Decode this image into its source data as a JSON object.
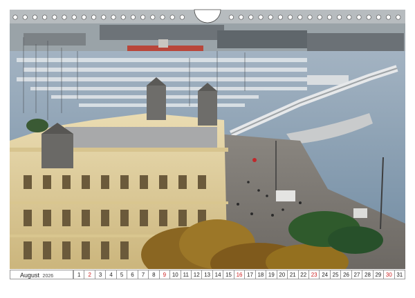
{
  "calendar": {
    "month": "August",
    "year": "2026",
    "days": [
      {
        "n": "1",
        "red": false
      },
      {
        "n": "2",
        "red": true
      },
      {
        "n": "3",
        "red": false
      },
      {
        "n": "4",
        "red": false
      },
      {
        "n": "5",
        "red": false
      },
      {
        "n": "6",
        "red": false
      },
      {
        "n": "7",
        "red": false
      },
      {
        "n": "8",
        "red": false
      },
      {
        "n": "9",
        "red": true
      },
      {
        "n": "10",
        "red": false
      },
      {
        "n": "11",
        "red": false
      },
      {
        "n": "12",
        "red": false
      },
      {
        "n": "13",
        "red": false
      },
      {
        "n": "14",
        "red": false
      },
      {
        "n": "15",
        "red": false
      },
      {
        "n": "16",
        "red": true
      },
      {
        "n": "17",
        "red": false
      },
      {
        "n": "18",
        "red": false
      },
      {
        "n": "19",
        "red": false
      },
      {
        "n": "20",
        "red": false
      },
      {
        "n": "21",
        "red": false
      },
      {
        "n": "22",
        "red": false
      },
      {
        "n": "23",
        "red": true
      },
      {
        "n": "24",
        "red": false
      },
      {
        "n": "25",
        "red": false
      },
      {
        "n": "26",
        "red": false
      },
      {
        "n": "27",
        "red": false
      },
      {
        "n": "28",
        "red": false
      },
      {
        "n": "29",
        "red": false
      },
      {
        "n": "30",
        "red": true
      },
      {
        "n": "31",
        "red": false
      }
    ]
  },
  "colors": {
    "sunday": "#cc1f1f",
    "water": "#7f97ad",
    "building": "#e6d6a6",
    "trees": "#7a5a1c"
  },
  "photo": {
    "subject": "harbor-marina-with-ornate-building-and-promenade"
  }
}
